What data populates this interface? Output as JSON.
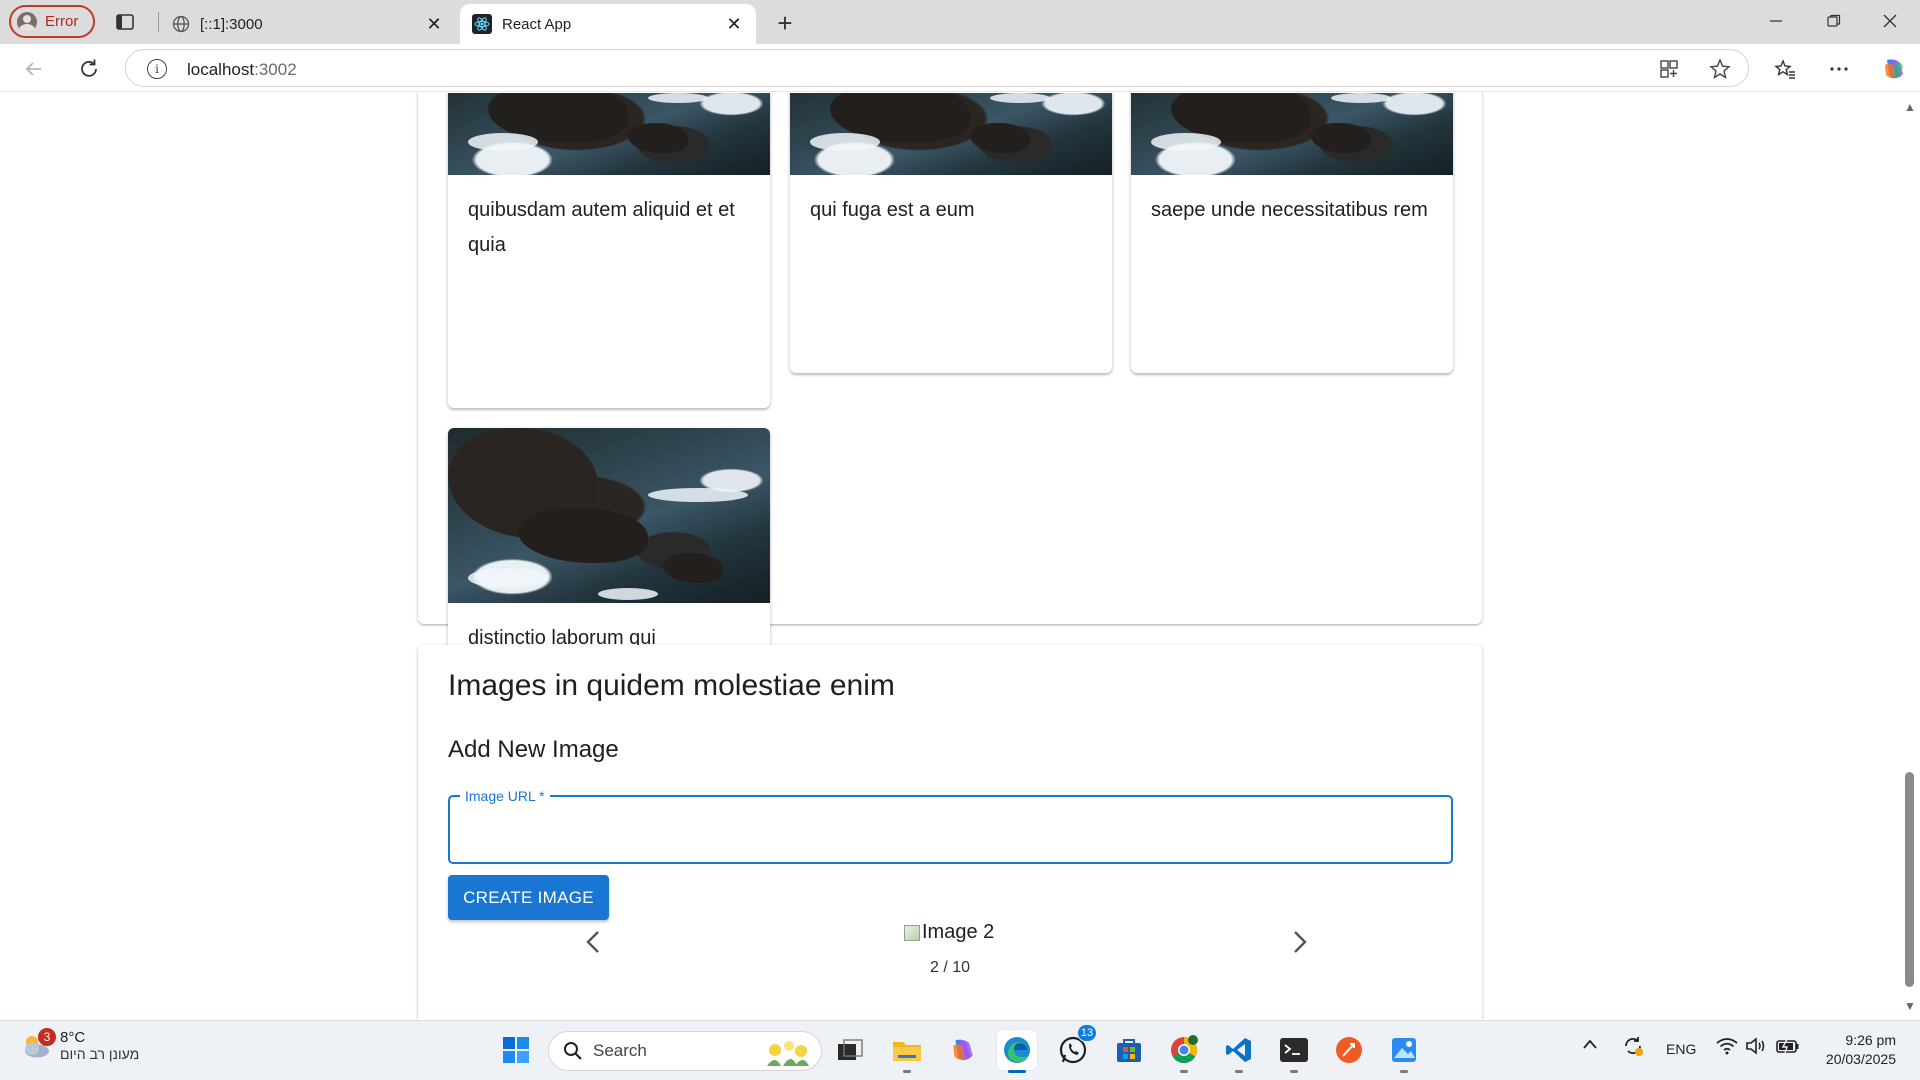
{
  "browser": {
    "profile_status": "Error",
    "tabs": [
      {
        "title": "[::1]:3000",
        "active": false
      },
      {
        "title": "React App",
        "active": true
      }
    ],
    "address": {
      "host": "localhost",
      "port": ":3002"
    }
  },
  "page": {
    "cards": [
      {
        "caption": "quibusdam autem aliquid et et quia"
      },
      {
        "caption": "qui fuga est a eum"
      },
      {
        "caption": "saepe unde necessitatibus rem"
      },
      {
        "caption": "distinctio laborum qui"
      }
    ],
    "section_title": "Images in quidem molestiae enim",
    "form": {
      "heading": "Add New Image",
      "field_label": "Image URL *",
      "field_value": "",
      "submit_label": "CREATE IMAGE"
    },
    "carousel": {
      "image_alt": "Image 2",
      "counter": "2 / 10"
    }
  },
  "taskbar": {
    "weather": {
      "temp": "8°C",
      "desc": "מעונן רב היום",
      "badge": "3"
    },
    "search_placeholder": "Search",
    "whatsapp_badge": "13",
    "language": "ENG",
    "time": "9:26 pm",
    "date": "20/03/2025"
  },
  "colors": {
    "primary": "#1976d2",
    "error": "#b3261e",
    "taskbar_bg": "#eef1f5"
  }
}
